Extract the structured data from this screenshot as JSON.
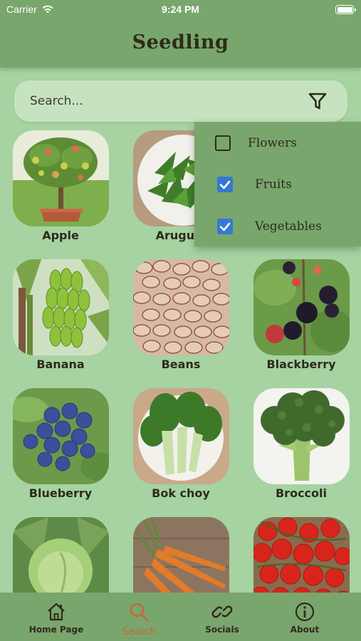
{
  "status_bar": {
    "carrier": "Carrier",
    "time": "9:24 PM"
  },
  "header": {
    "title": "Seedling"
  },
  "search": {
    "placeholder": "Search...",
    "value": "",
    "filter_icon": "filter-icon"
  },
  "filter_menu": {
    "items": [
      {
        "label": "Flowers",
        "checked": false
      },
      {
        "label": "Fruits",
        "checked": true
      },
      {
        "label": "Vegetables",
        "checked": true
      }
    ]
  },
  "plants": [
    {
      "name": "Apple"
    },
    {
      "name": "Arugula"
    },
    {
      "name": ""
    },
    {
      "name": "Banana"
    },
    {
      "name": "Beans"
    },
    {
      "name": "Blackberry"
    },
    {
      "name": "Blueberry"
    },
    {
      "name": "Bok choy"
    },
    {
      "name": "Broccoli"
    },
    {
      "name": ""
    },
    {
      "name": ""
    },
    {
      "name": ""
    }
  ],
  "tabbar": {
    "tabs": [
      {
        "label": "Home Page",
        "icon": "home-icon",
        "active": false
      },
      {
        "label": "Search",
        "icon": "search-icon",
        "active": true
      },
      {
        "label": "Socials",
        "icon": "link-icon",
        "active": false
      },
      {
        "label": "About",
        "icon": "info-icon",
        "active": false
      }
    ]
  },
  "colors": {
    "background": "#a6d3a1",
    "header": "#79a66c",
    "accent_active_tab": "#c4683a",
    "checkbox": "#3478d4"
  }
}
